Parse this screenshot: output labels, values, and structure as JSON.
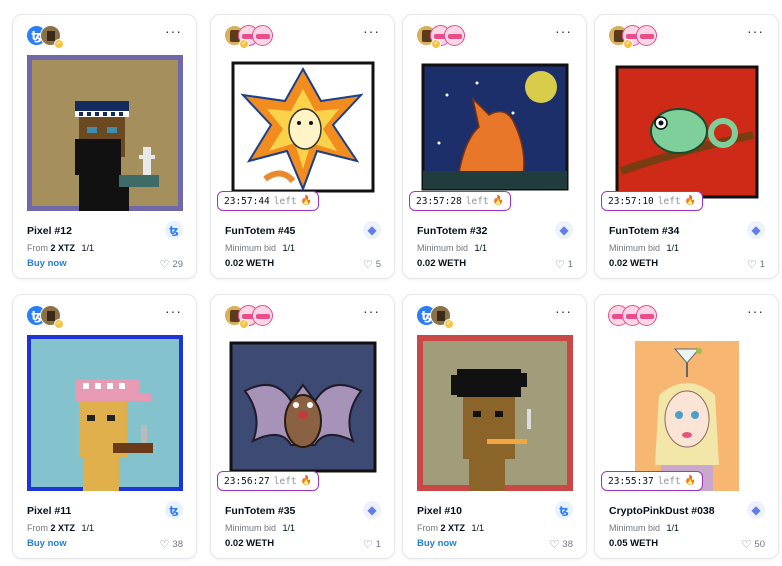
{
  "cards": [
    {
      "title": "Pixel #12",
      "price_label": "From",
      "price": "2 XTZ",
      "edition": "1/1",
      "action": "Buy now",
      "likes": "29",
      "chain_icon": "tezos-icon",
      "timer": ""
    },
    {
      "title": "FunTotem #45",
      "price_label": "Minimum bid",
      "edition": "1/1",
      "value": "0.02 WETH",
      "likes": "5",
      "chain_icon": "ethereum-icon",
      "timer": "23:57:44",
      "timer_suffix": "left"
    },
    {
      "title": "FunTotem #32",
      "price_label": "Minimum bid",
      "edition": "1/1",
      "value": "0.02 WETH",
      "likes": "1",
      "chain_icon": "ethereum-icon",
      "timer": "23:57:28",
      "timer_suffix": "left"
    },
    {
      "title": "FunTotem #34",
      "price_label": "Minimum bid",
      "edition": "1/1",
      "value": "0.02 WETH",
      "likes": "1",
      "chain_icon": "ethereum-icon",
      "timer": "23:57:10",
      "timer_suffix": "left"
    },
    {
      "title": "Pixel #11",
      "price_label": "From",
      "price": "2 XTZ",
      "edition": "1/1",
      "action": "Buy now",
      "likes": "38",
      "chain_icon": "tezos-icon",
      "timer": ""
    },
    {
      "title": "FunTotem #35",
      "price_label": "Minimum bid",
      "edition": "1/1",
      "value": "0.02 WETH",
      "likes": "1",
      "chain_icon": "ethereum-icon",
      "timer": "23:56:27",
      "timer_suffix": "left"
    },
    {
      "title": "Pixel #10",
      "price_label": "From",
      "price": "2 XTZ",
      "edition": "1/1",
      "action": "Buy now",
      "likes": "38",
      "chain_icon": "tezos-icon",
      "timer": ""
    },
    {
      "title": "CryptoPinkDust #038",
      "price_label": "Minimum bid",
      "edition": "1/1",
      "value": "0.05 WETH",
      "likes": "50",
      "chain_icon": "ethereum-icon",
      "timer": "23:55:37",
      "timer_suffix": "left"
    }
  ],
  "colors": {
    "accent": "#2081e2",
    "timer_border": "#a332c9",
    "fire": "#f26a21"
  }
}
